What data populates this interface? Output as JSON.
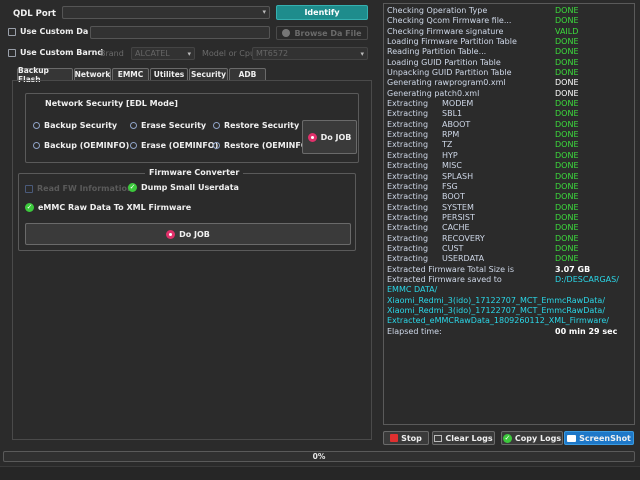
{
  "top": {
    "qdl_port_label": "QDL Port",
    "qdl_port_value": "",
    "identify_label": "Identify",
    "use_custom_da_label": "Use Custom Da",
    "browse_da_label": "Browse Da File",
    "use_custom_brand_label": "Use Custom Barnd",
    "brand_label": "Brand",
    "brand_value": "ALCATEL",
    "model_label": "Model or Cpu",
    "model_value": "MT6572"
  },
  "tabs": [
    "Backup  Flash",
    "Network",
    "EMMC",
    "Utilites",
    "Security",
    "ADB"
  ],
  "network_security": {
    "title": "Network Security [EDL Mode]",
    "options": [
      "Backup Security",
      "Erase Security",
      "Restore Security",
      "Backup (OEMINFO)",
      "Erase (OEMINFO)",
      "Restore (OEMINFO)"
    ],
    "do_job_label": "Do JOB"
  },
  "firmware_converter": {
    "title": "Firmware Converter",
    "read_fw_label": "Read FW Information",
    "dump_userdata_label": "Dump Small Userdata",
    "emmc_raw_label": "eMMC Raw Data To XML Firmware",
    "do_job_label": "Do JOB"
  },
  "log": {
    "status_lines": [
      {
        "key": "Checking Operation Type",
        "val": "DONE"
      },
      {
        "key": "Checking Qcom Firmware file...",
        "val": "DONE"
      },
      {
        "key": "Checking  Firmware signature",
        "val": "VAILD"
      },
      {
        "key": "Loading Firmware Partition Table",
        "val": "DONE"
      },
      {
        "key": "Reading Partition Table...",
        "val": "DONE"
      },
      {
        "key": "Loading GUID Partition Table",
        "val": "DONE"
      },
      {
        "key": "Unpacking GUID Partition Table",
        "val": "DONE"
      },
      {
        "key": "Generating rawprogram0.xml",
        "val": "DONE"
      },
      {
        "key": "Generating patch0.xml",
        "val": "DONE"
      }
    ],
    "extracting_label": "Extracting",
    "partitions": [
      "MODEM",
      "SBL1",
      "ABOOT",
      "RPM",
      "TZ",
      "HYP",
      "MISC",
      "SPLASH",
      "FSG",
      "BOOT",
      "SYSTEM",
      "PERSIST",
      "CACHE",
      "RECOVERY",
      "CUST",
      "USERDATA"
    ],
    "done_label": "DONE",
    "total_size_label": "Extracted Firmware Total Size is",
    "total_size_value": "3.07 GB",
    "saved_to_label": "Extracted Firmware saved to",
    "saved_to_value": "D:/DESCARGAS/",
    "path_lines": [
      "EMMC DATA/",
      "Xiaomi_Redmi_3(ido)_17122707_MCT_EmmcRawData/",
      "Xiaomi_Redmi_3(ido)_17122707_MCT_EmmcRawData/",
      "Extracted_eMMCRawData_1809260112_XML_Firmware/"
    ],
    "elapsed_label": "Elapsed time:",
    "elapsed_value": "00 min  29 sec"
  },
  "bottom": {
    "stop_label": "Stop",
    "clear_logs_label": "Clear Logs",
    "copy_logs_label": "Copy Logs",
    "screenshot_label": "ScreenShot",
    "progress_text": "0%",
    "progress_value": 0
  },
  "colors": {
    "done_green": "#3cdc3c",
    "white_status": "#ffffff",
    "cyan_path": "#2ad7e8",
    "identify_teal": "#1e8c8c",
    "screenshot_blue": "#1e78c8"
  }
}
